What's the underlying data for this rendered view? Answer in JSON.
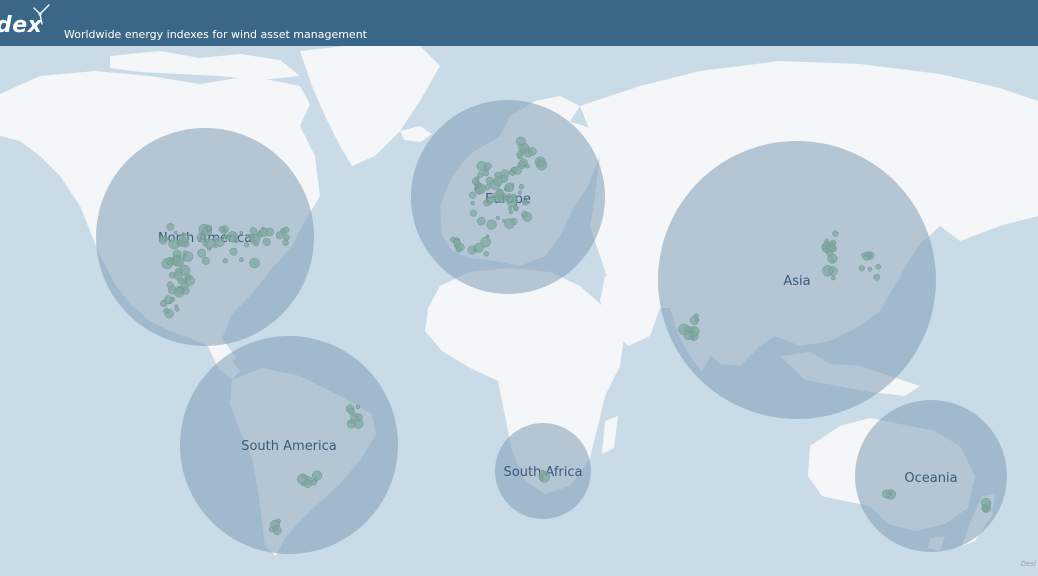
{
  "header": {
    "logo_text": "dex",
    "tagline": "Worldwide energy indexes for wind asset management"
  },
  "map": {
    "colors": {
      "ocean": "#c9dbe6",
      "land": "#f4f6f7",
      "region_circle": "#7f9cb8",
      "site_marker": "#7fa8a0",
      "header": "#3a6688"
    },
    "regions": [
      {
        "id": "north-america",
        "label": "North America"
      },
      {
        "id": "europe",
        "label": "Europe"
      },
      {
        "id": "asia",
        "label": "Asia"
      },
      {
        "id": "south-america",
        "label": "South America"
      },
      {
        "id": "south-africa",
        "label": "South Africa"
      },
      {
        "id": "oceania",
        "label": "Oceania"
      }
    ],
    "credit": "Desi"
  }
}
